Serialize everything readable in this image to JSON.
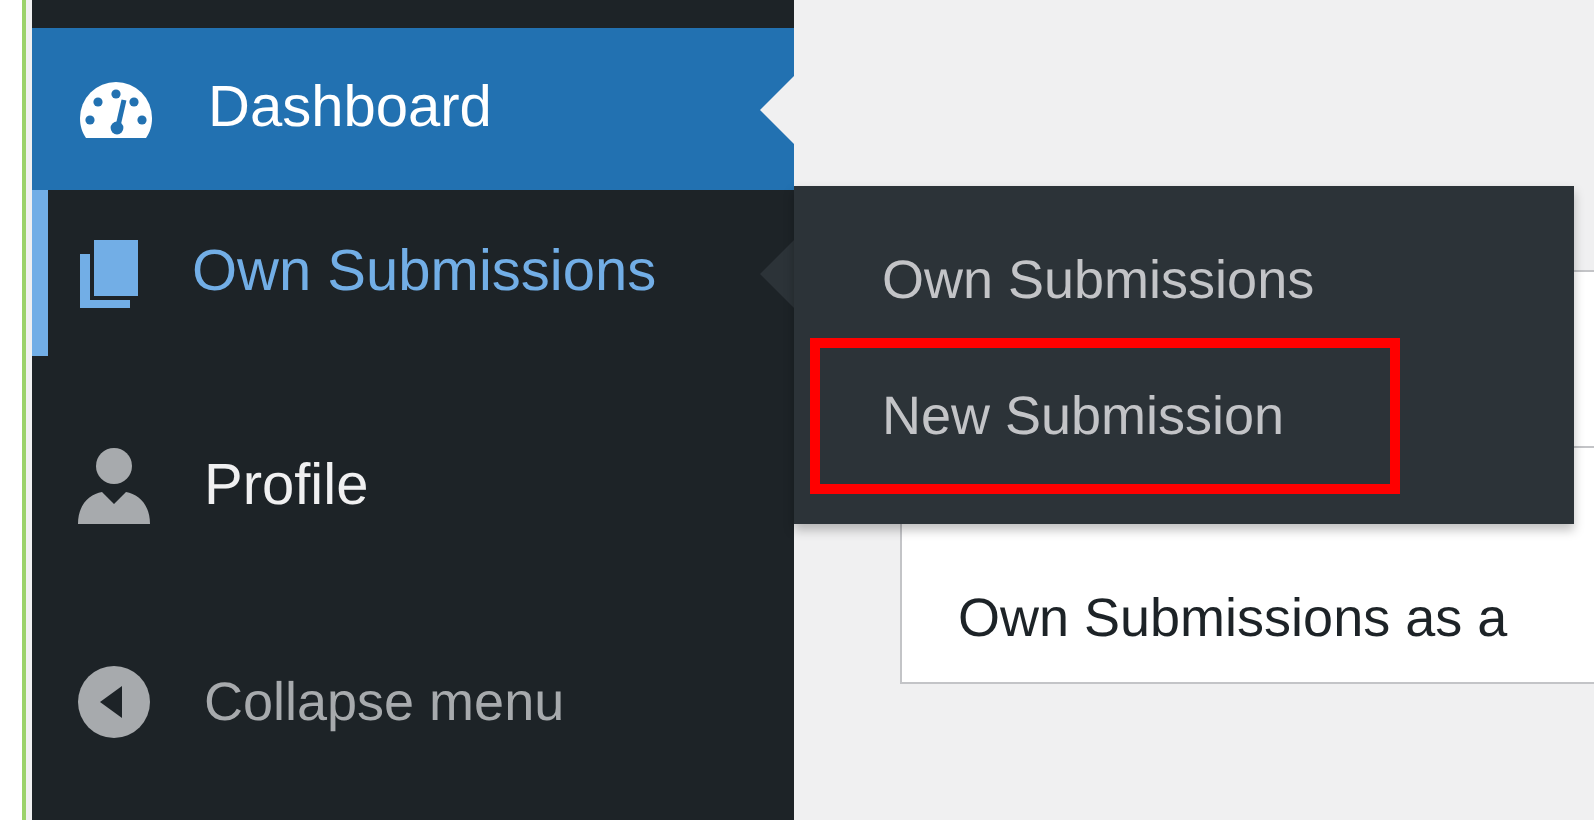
{
  "sidebar": {
    "items": [
      {
        "label": "Dashboard",
        "kind": "dashboard",
        "selected": true,
        "open": false
      },
      {
        "label": "Own Submissions",
        "kind": "submissions",
        "selected": false,
        "open": true
      },
      {
        "label": "Profile",
        "kind": "profile",
        "selected": false,
        "open": false
      },
      {
        "label": "Collapse menu",
        "kind": "collapse",
        "selected": false,
        "open": false
      }
    ]
  },
  "submenu": {
    "items": [
      {
        "label": "Own Submissions",
        "highlighted": false
      },
      {
        "label": "New Submission",
        "highlighted": true
      }
    ]
  },
  "content": {
    "card_text": "Own Submissions as a"
  }
}
